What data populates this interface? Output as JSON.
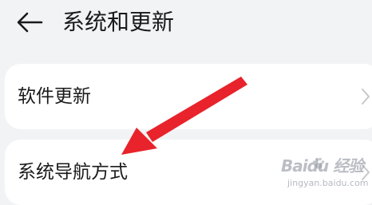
{
  "header": {
    "back_icon": "arrow-left-icon",
    "title": "系统和更新"
  },
  "menu": {
    "items": [
      {
        "label": "软件更新",
        "icon": "chevron-right-icon"
      },
      {
        "label": "系统导航方式",
        "icon": "chevron-right-icon"
      }
    ]
  },
  "annotation": {
    "arrow_color": "#e8232b"
  },
  "watermark": {
    "brand": "Baidu 经验",
    "url": "jingyan.baidu.com"
  },
  "colors": {
    "background": "#f1f3f5",
    "card": "#ffffff",
    "text": "#1a1a1a",
    "chevron": "#c8c8c8"
  }
}
